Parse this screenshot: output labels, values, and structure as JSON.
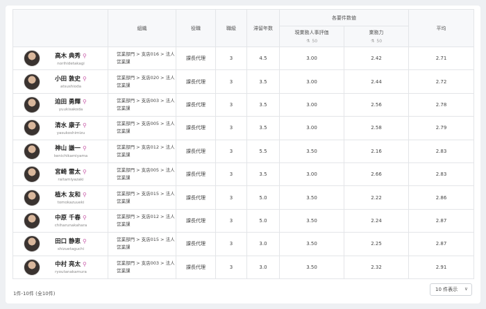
{
  "columns": {
    "org": "組織",
    "position": "役職",
    "grade": "職級",
    "tenure": "滞留年数",
    "group": "各要件数値",
    "eval": "現業務人事評価",
    "eval_max": "50",
    "ability": "業務力",
    "ability_max": "50",
    "avg": "平均"
  },
  "icons": {
    "search": "search-icon",
    "flask": "flask-icon",
    "chevron": "chevron-down-icon"
  },
  "rows": [
    {
      "name": "高木 典秀",
      "romaji": "norihidetakagi",
      "org1": "営業部門 > 支店016 > 法人",
      "org2": "営業課",
      "position": "課長代理",
      "grade": "3",
      "tenure": "4.5",
      "eval": "3.00",
      "ability": "2.42",
      "avg": "2.71"
    },
    {
      "name": "小田 敦史",
      "romaji": "atsushioda",
      "org1": "営業部門 > 支店020 > 法人",
      "org2": "営業課",
      "position": "課長代理",
      "grade": "3",
      "tenure": "3.5",
      "eval": "3.00",
      "ability": "2.44",
      "avg": "2.72"
    },
    {
      "name": "迫田 勇輝",
      "romaji": "yuukisakoda",
      "org1": "営業部門 > 支店003 > 法人",
      "org2": "営業課",
      "position": "課長代理",
      "grade": "3",
      "tenure": "3.5",
      "eval": "3.00",
      "ability": "2.56",
      "avg": "2.78"
    },
    {
      "name": "清水 康子",
      "romaji": "yasukoshimizu",
      "org1": "営業部門 > 支店005 > 法人",
      "org2": "営業課",
      "position": "課長代理",
      "grade": "3",
      "tenure": "3.5",
      "eval": "3.00",
      "ability": "2.58",
      "avg": "2.79"
    },
    {
      "name": "神山 謙一",
      "romaji": "kenichikamiyama",
      "org1": "営業部門 > 支店012 > 法人",
      "org2": "営業課",
      "position": "課長代理",
      "grade": "3",
      "tenure": "5.5",
      "eval": "3.50",
      "ability": "2.16",
      "avg": "2.83"
    },
    {
      "name": "宮崎 雷太",
      "romaji": "raitamiyazaki",
      "org1": "営業部門 > 支店005 > 法人",
      "org2": "営業課",
      "position": "課長代理",
      "grade": "3",
      "tenure": "3.5",
      "eval": "3.00",
      "ability": "2.66",
      "avg": "2.83"
    },
    {
      "name": "植木 友和",
      "romaji": "tomokazuueki",
      "org1": "営業部門 > 支店015 > 法人",
      "org2": "営業課",
      "position": "課長代理",
      "grade": "3",
      "tenure": "5.0",
      "eval": "3.50",
      "ability": "2.22",
      "avg": "2.86"
    },
    {
      "name": "中原 千春",
      "romaji": "chiharunakahara",
      "org1": "営業部門 > 支店012 > 法人",
      "org2": "営業課",
      "position": "課長代理",
      "grade": "3",
      "tenure": "5.0",
      "eval": "3.50",
      "ability": "2.24",
      "avg": "2.87"
    },
    {
      "name": "田口 静恵",
      "romaji": "shizuetaguchi",
      "org1": "営業部門 > 支店015 > 法人",
      "org2": "営業課",
      "position": "課長代理",
      "grade": "3",
      "tenure": "3.0",
      "eval": "3.50",
      "ability": "2.25",
      "avg": "2.87"
    },
    {
      "name": "中村 亮太",
      "romaji": "ryoutanakamura",
      "org1": "営業部門 > 支店003 > 法人",
      "org2": "営業課",
      "position": "課長代理",
      "grade": "3",
      "tenure": "3.0",
      "eval": "3.50",
      "ability": "2.32",
      "avg": "2.91"
    }
  ],
  "footer": {
    "count": "1件-10件 (全10件)",
    "per_page": "10 件表示"
  }
}
